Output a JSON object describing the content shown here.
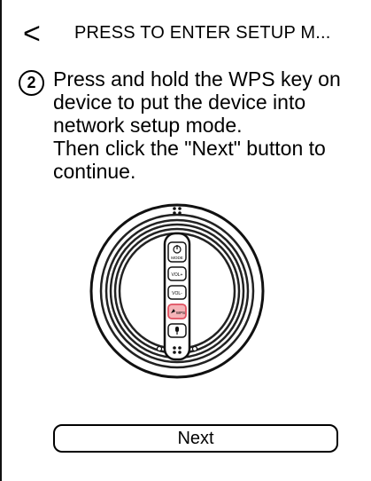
{
  "header": {
    "back_glyph": "<",
    "title": "PRESS TO ENTER SETUP M..."
  },
  "step": {
    "number": "2",
    "line1": "Press and hold the WPS key on device to put the device into network setup mode.",
    "line2": "Then click the \"Next\" button to continue."
  },
  "device": {
    "keys": [
      "MODE",
      "VOL+",
      "VOL-",
      "WPS"
    ],
    "highlight_color": "#e05060"
  },
  "footer": {
    "next_label": "Next"
  }
}
